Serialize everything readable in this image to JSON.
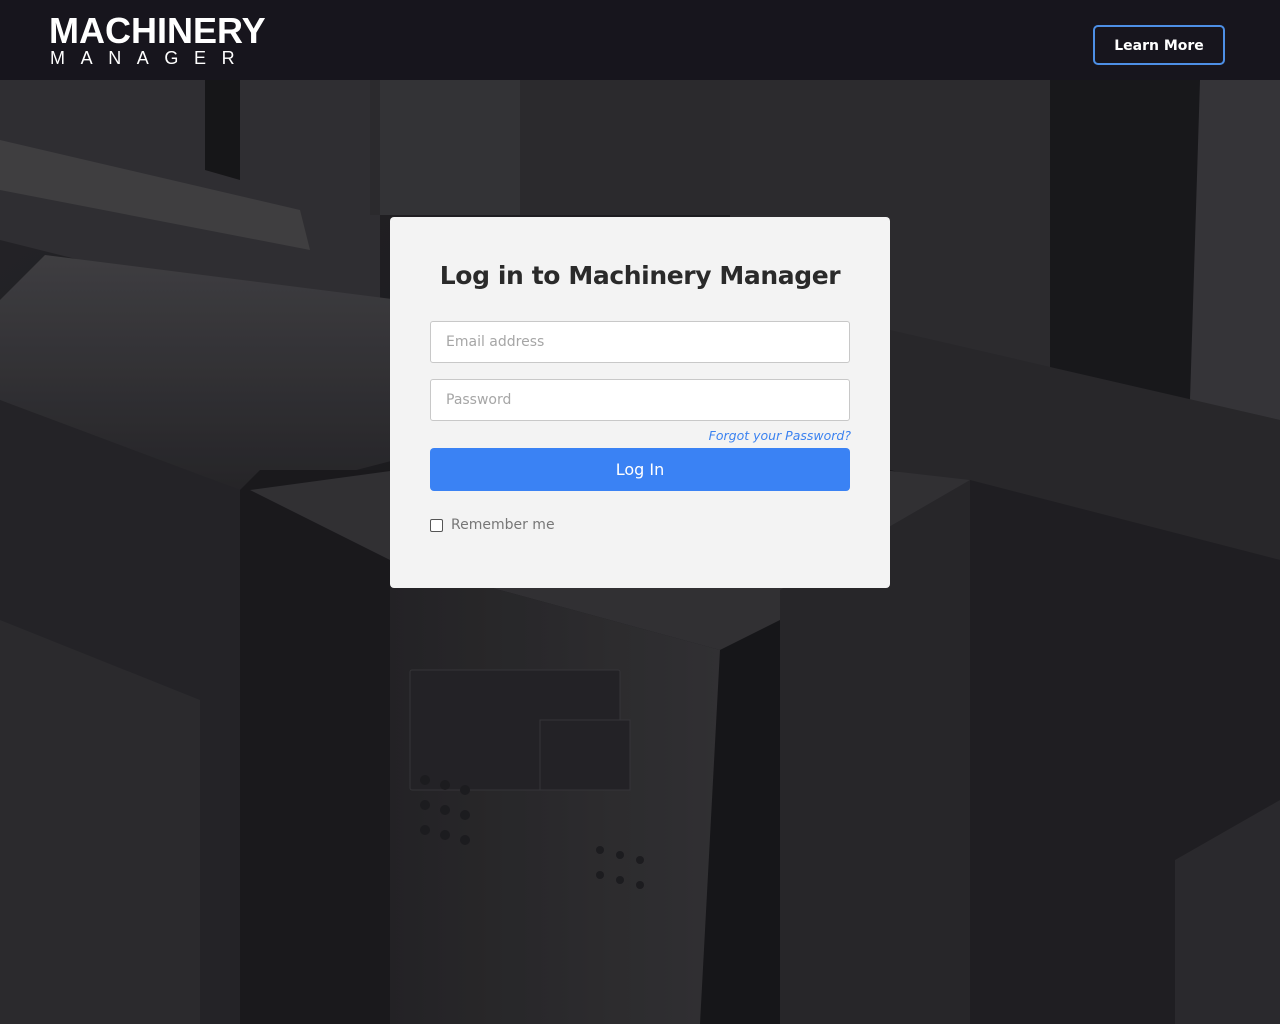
{
  "header": {
    "logo_top": "MACHINERY",
    "logo_bottom": "MANAGER",
    "learn_more_label": "Learn More"
  },
  "login": {
    "title": "Log in to Machinery Manager",
    "email_placeholder": "Email address",
    "email_value": "",
    "password_placeholder": "Password",
    "password_value": "",
    "forgot_label": "Forgot your Password?",
    "submit_label": "Log In",
    "remember_label": "Remember me",
    "remember_checked": false
  },
  "colors": {
    "header_bg": "#17151d",
    "accent": "#3a82f4",
    "learn_more_border": "#4d8fe6",
    "card_bg": "#f3f3f3"
  }
}
